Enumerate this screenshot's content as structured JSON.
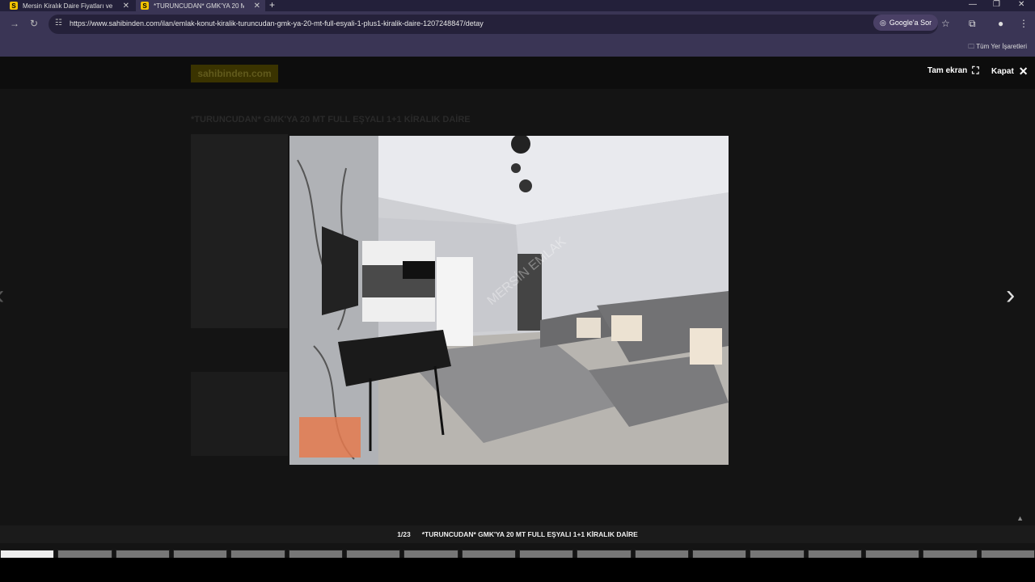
{
  "browser": {
    "tabs": [
      {
        "favicon": "S",
        "title": "Mersin Kiralık Daire Fiyatları ve",
        "active": false
      },
      {
        "favicon": "S",
        "title": "*TURUNCUDAN* GMK'YA 20 M",
        "active": true
      }
    ],
    "new_tab": "+",
    "url": "https://www.sahibinden.com/ilan/emlak-konut-kiralik-turuncudan-gmk-ya-20-mt-full-esyali-1-plus1-kiralik-daire-1207248847/detay",
    "google_sor_label": "Google'a Sor",
    "bookmarks_label": "Tüm Yer İşaretleri"
  },
  "site": {
    "logo": "sahibinden.com",
    "listing_title_bg": "*TURUNCUDAN* GMK'YA 20 MT FULL EŞYALI 1+1 KİRALIK DAİRE"
  },
  "viewer": {
    "fullscreen_label": "Tam ekran",
    "close_label": "Kapat",
    "counter": "1/23",
    "caption": "*TURUNCUDAN* GMK'YA 20 MT FULL EŞYALI 1+1 KİRALIK DAİRE",
    "photo_watermark": "MERSİN EMLAK",
    "thumbnail_count": 18
  },
  "icons": {
    "fullscreen": "fullscreen-icon",
    "close": "close-icon",
    "prev": "chevron-left-icon",
    "next": "chevron-right-icon"
  }
}
